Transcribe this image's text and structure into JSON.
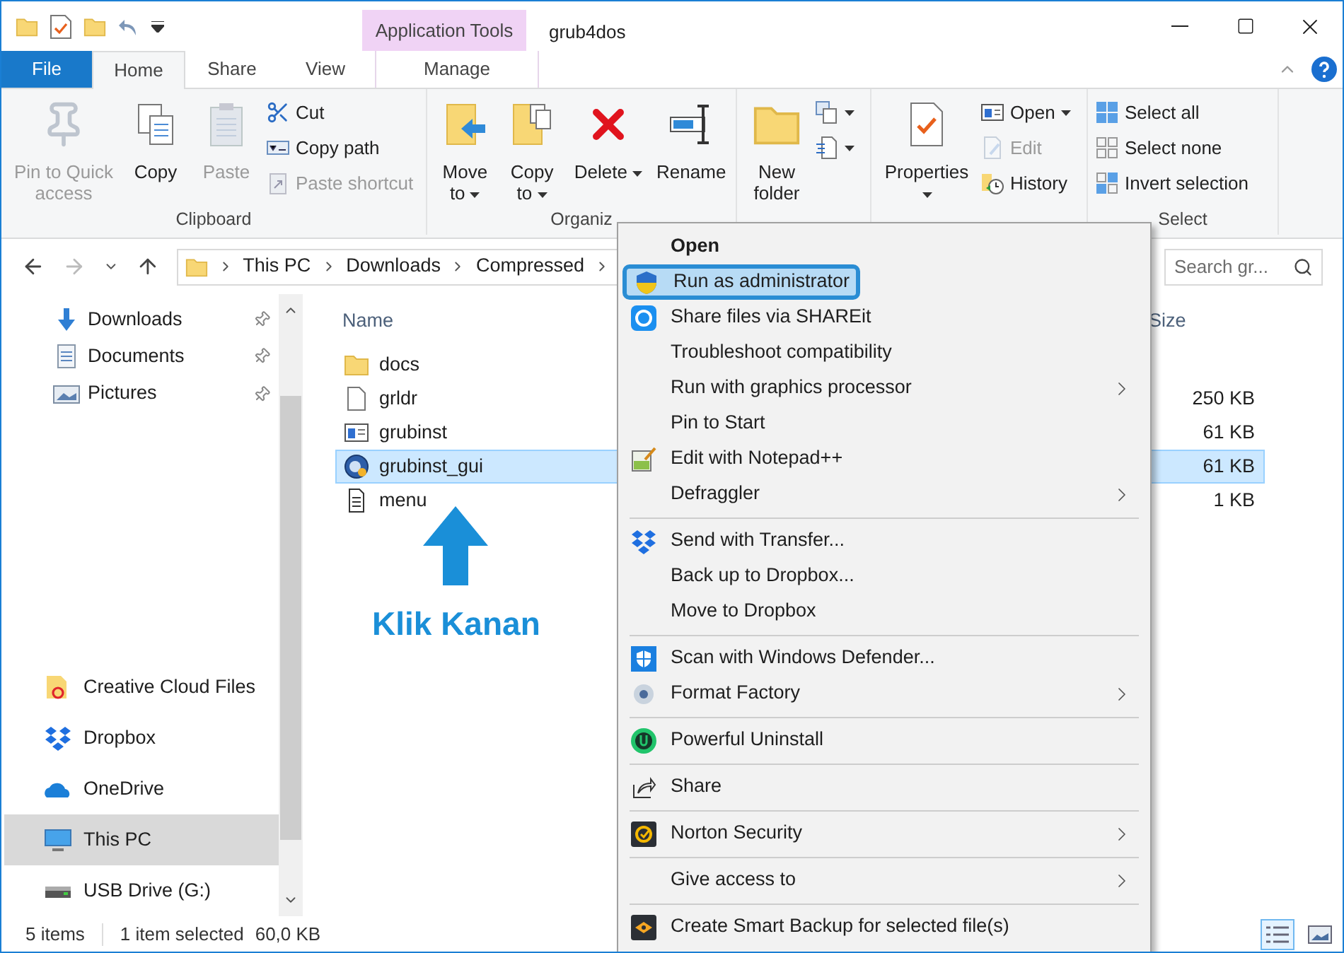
{
  "window": {
    "title": "grub4dos",
    "context_tab_group": "Application Tools"
  },
  "ribbon_tabs": [
    {
      "label": "File",
      "kind": "file",
      "selected": false
    },
    {
      "label": "Home",
      "kind": "tab",
      "selected": true
    },
    {
      "label": "Share",
      "kind": "tab",
      "selected": false
    },
    {
      "label": "View",
      "kind": "tab",
      "selected": false
    },
    {
      "label": "Manage",
      "kind": "context",
      "selected": false
    }
  ],
  "ribbon_groups": [
    {
      "label": "Clipboard",
      "buttons": [
        {
          "kind": "large",
          "label": "Pin to Quick access",
          "disabled": true,
          "dropdown": false
        },
        {
          "kind": "large",
          "label": "Copy",
          "disabled": false,
          "dropdown": false
        },
        {
          "kind": "large",
          "label": "Paste",
          "disabled": true,
          "dropdown": false
        },
        {
          "kind": "stack",
          "items": [
            {
              "label": "Cut",
              "disabled": false,
              "dropdown": false
            },
            {
              "label": "Copy path",
              "disabled": false,
              "dropdown": false
            },
            {
              "label": "Paste shortcut",
              "disabled": true,
              "dropdown": false
            }
          ]
        }
      ]
    },
    {
      "label": "Organiz",
      "buttons": [
        {
          "kind": "large",
          "label": "Move to",
          "disabled": false,
          "dropdown": true
        },
        {
          "kind": "large",
          "label": "Copy to",
          "disabled": false,
          "dropdown": true
        },
        {
          "kind": "large",
          "label": "Delete",
          "disabled": false,
          "dropdown": true
        },
        {
          "kind": "large",
          "label": "Rename",
          "disabled": false,
          "dropdown": false
        }
      ]
    },
    {
      "buttons": [
        {
          "kind": "large",
          "label": "New folder",
          "disabled": false,
          "dropdown": false
        },
        {
          "kind": "stack",
          "items": [
            {
              "disabled": false,
              "dropdown": true
            },
            {
              "disabled": false,
              "dropdown": true
            }
          ]
        }
      ]
    },
    {
      "buttons": [
        {
          "kind": "large",
          "label": "Properties",
          "disabled": false,
          "dropdown": true
        },
        {
          "kind": "stack",
          "items": [
            {
              "label": "Open",
              "disabled": false,
              "dropdown": true
            },
            {
              "label": "Edit",
              "disabled": true,
              "dropdown": false
            },
            {
              "label": "History",
              "disabled": false,
              "dropdown": false
            }
          ]
        }
      ]
    },
    {
      "label": "Select",
      "buttons": [
        {
          "kind": "stack",
          "items": [
            {
              "label": "Select all",
              "disabled": false,
              "dropdown": false
            },
            {
              "label": "Select none",
              "disabled": false,
              "dropdown": false
            },
            {
              "label": "Invert selection",
              "disabled": false,
              "dropdown": false
            }
          ]
        }
      ]
    }
  ],
  "address": {
    "path": [
      "This PC",
      "Downloads",
      "Compressed"
    ],
    "search_placeholder": "Search gr..."
  },
  "quick_access": [
    {
      "label": "Downloads",
      "selected": false,
      "pinned": true
    },
    {
      "label": "Documents",
      "selected": false,
      "pinned": true
    },
    {
      "label": "Pictures",
      "selected": false,
      "pinned": true
    }
  ],
  "locations": [
    {
      "label": "Creative Cloud Files",
      "selected": false
    },
    {
      "label": "Dropbox",
      "selected": false
    },
    {
      "label": "OneDrive",
      "selected": false
    },
    {
      "label": "This PC",
      "selected": true
    },
    {
      "label": "USB Drive (G:)",
      "selected": false
    }
  ],
  "file_list": {
    "columns": [
      "Name",
      "Size"
    ],
    "rows": [
      {
        "name": "docs",
        "kind": "folder",
        "selected": false
      },
      {
        "name": "grldr",
        "kind": "file",
        "size": "250 KB",
        "selected": false
      },
      {
        "name": "grubinst",
        "kind": "app",
        "size": "61 KB",
        "selected": false
      },
      {
        "name": "grubinst_gui",
        "kind": "gui",
        "size": "61 KB",
        "selected": true
      },
      {
        "name": "menu",
        "kind": "text",
        "size": "1 KB",
        "selected": false
      }
    ]
  },
  "annotation": {
    "label": "Klik Kanan"
  },
  "context_menu": {
    "sections": [
      [
        {
          "label": "Open",
          "default": true,
          "selected": false,
          "submenu": false
        },
        {
          "label": "Run as administrator",
          "default": false,
          "selected": true,
          "submenu": false
        },
        {
          "label": "Share files via SHAREit",
          "default": false,
          "selected": false,
          "submenu": false
        },
        {
          "label": "Troubleshoot compatibility",
          "default": false,
          "selected": false,
          "submenu": false
        },
        {
          "label": "Run with graphics processor",
          "default": false,
          "selected": false,
          "submenu": true
        },
        {
          "label": "Pin to Start",
          "default": false,
          "selected": false,
          "submenu": false
        },
        {
          "label": "Edit with Notepad++",
          "default": false,
          "selected": false,
          "submenu": false
        },
        {
          "label": "Defraggler",
          "default": false,
          "selected": false,
          "submenu": true
        }
      ],
      [
        {
          "label": "Send with Transfer...",
          "default": false,
          "selected": false,
          "submenu": false
        },
        {
          "label": "Back up to Dropbox...",
          "default": false,
          "selected": false,
          "submenu": false
        },
        {
          "label": "Move to Dropbox",
          "default": false,
          "selected": false,
          "submenu": false
        }
      ],
      [
        {
          "label": "Scan with Windows Defender...",
          "default": false,
          "selected": false,
          "submenu": false
        },
        {
          "label": "Format Factory",
          "default": false,
          "selected": false,
          "submenu": true
        }
      ],
      [
        {
          "label": "Powerful Uninstall",
          "default": false,
          "selected": false,
          "submenu": false
        }
      ],
      [
        {
          "label": "Share",
          "default": false,
          "selected": false,
          "submenu": false
        }
      ],
      [
        {
          "label": "Norton Security",
          "default": false,
          "selected": false,
          "submenu": true
        }
      ],
      [
        {
          "label": "Give access to",
          "default": false,
          "selected": false,
          "submenu": true
        }
      ],
      [
        {
          "label": "Create Smart Backup for selected file(s)",
          "default": false,
          "selected": false,
          "submenu": false
        }
      ]
    ]
  },
  "status_bar": {
    "item_count": "5 items",
    "selection": "1 item selected",
    "selection_size": "60,0 KB",
    "views": [
      {
        "kind": "details",
        "selected": true
      },
      {
        "kind": "thumbnails",
        "selected": false
      }
    ]
  }
}
